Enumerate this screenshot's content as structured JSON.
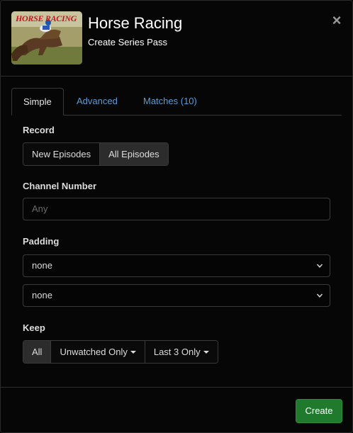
{
  "header": {
    "title": "Horse Racing",
    "subtitle": "Create Series Pass",
    "thumbnail_text": "HORSE RACING",
    "close_symbol": "×"
  },
  "tabs": [
    {
      "label": "Simple",
      "active": true
    },
    {
      "label": "Advanced",
      "active": false
    },
    {
      "label": "Matches (10)",
      "active": false
    }
  ],
  "record": {
    "label": "Record",
    "options": [
      "New Episodes",
      "All Episodes"
    ],
    "selected": "All Episodes"
  },
  "channel": {
    "label": "Channel Number",
    "placeholder": "Any",
    "value": ""
  },
  "padding": {
    "label": "Padding",
    "start_value": "none",
    "end_value": "none"
  },
  "keep": {
    "label": "Keep",
    "options": [
      "All",
      "Unwatched Only",
      "Last 3 Only"
    ],
    "selected": "All"
  },
  "footer": {
    "create_label": "Create"
  },
  "colors": {
    "accent_link": "#5b9bd5",
    "create_button": "#1f7a2e",
    "background": "#000000"
  }
}
